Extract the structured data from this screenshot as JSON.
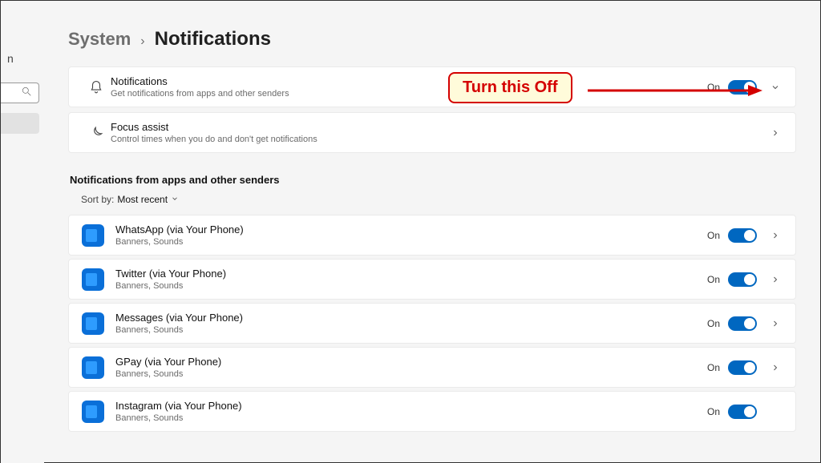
{
  "breadcrumb": {
    "parent": "System",
    "current": "Notifications"
  },
  "notifications_card": {
    "title": "Notifications",
    "subtitle": "Get notifications from apps and other senders",
    "state": "On"
  },
  "focus_card": {
    "title": "Focus assist",
    "subtitle": "Control times when you do and don't get notifications"
  },
  "section": {
    "header": "Notifications from apps and other senders",
    "sort_label": "Sort by:",
    "sort_value": "Most recent"
  },
  "apps": [
    {
      "name": "WhatsApp (via Your Phone)",
      "desc": "Banners, Sounds",
      "state": "On"
    },
    {
      "name": "Twitter (via Your Phone)",
      "desc": "Banners, Sounds",
      "state": "On"
    },
    {
      "name": "Messages (via Your Phone)",
      "desc": "Banners, Sounds",
      "state": "On"
    },
    {
      "name": "GPay (via Your Phone)",
      "desc": "Banners, Sounds",
      "state": "On"
    },
    {
      "name": "Instagram (via Your Phone)",
      "desc": "Banners, Sounds",
      "state": "On"
    }
  ],
  "annotation": {
    "text": "Turn this Off"
  },
  "left_stub_letter": "n"
}
